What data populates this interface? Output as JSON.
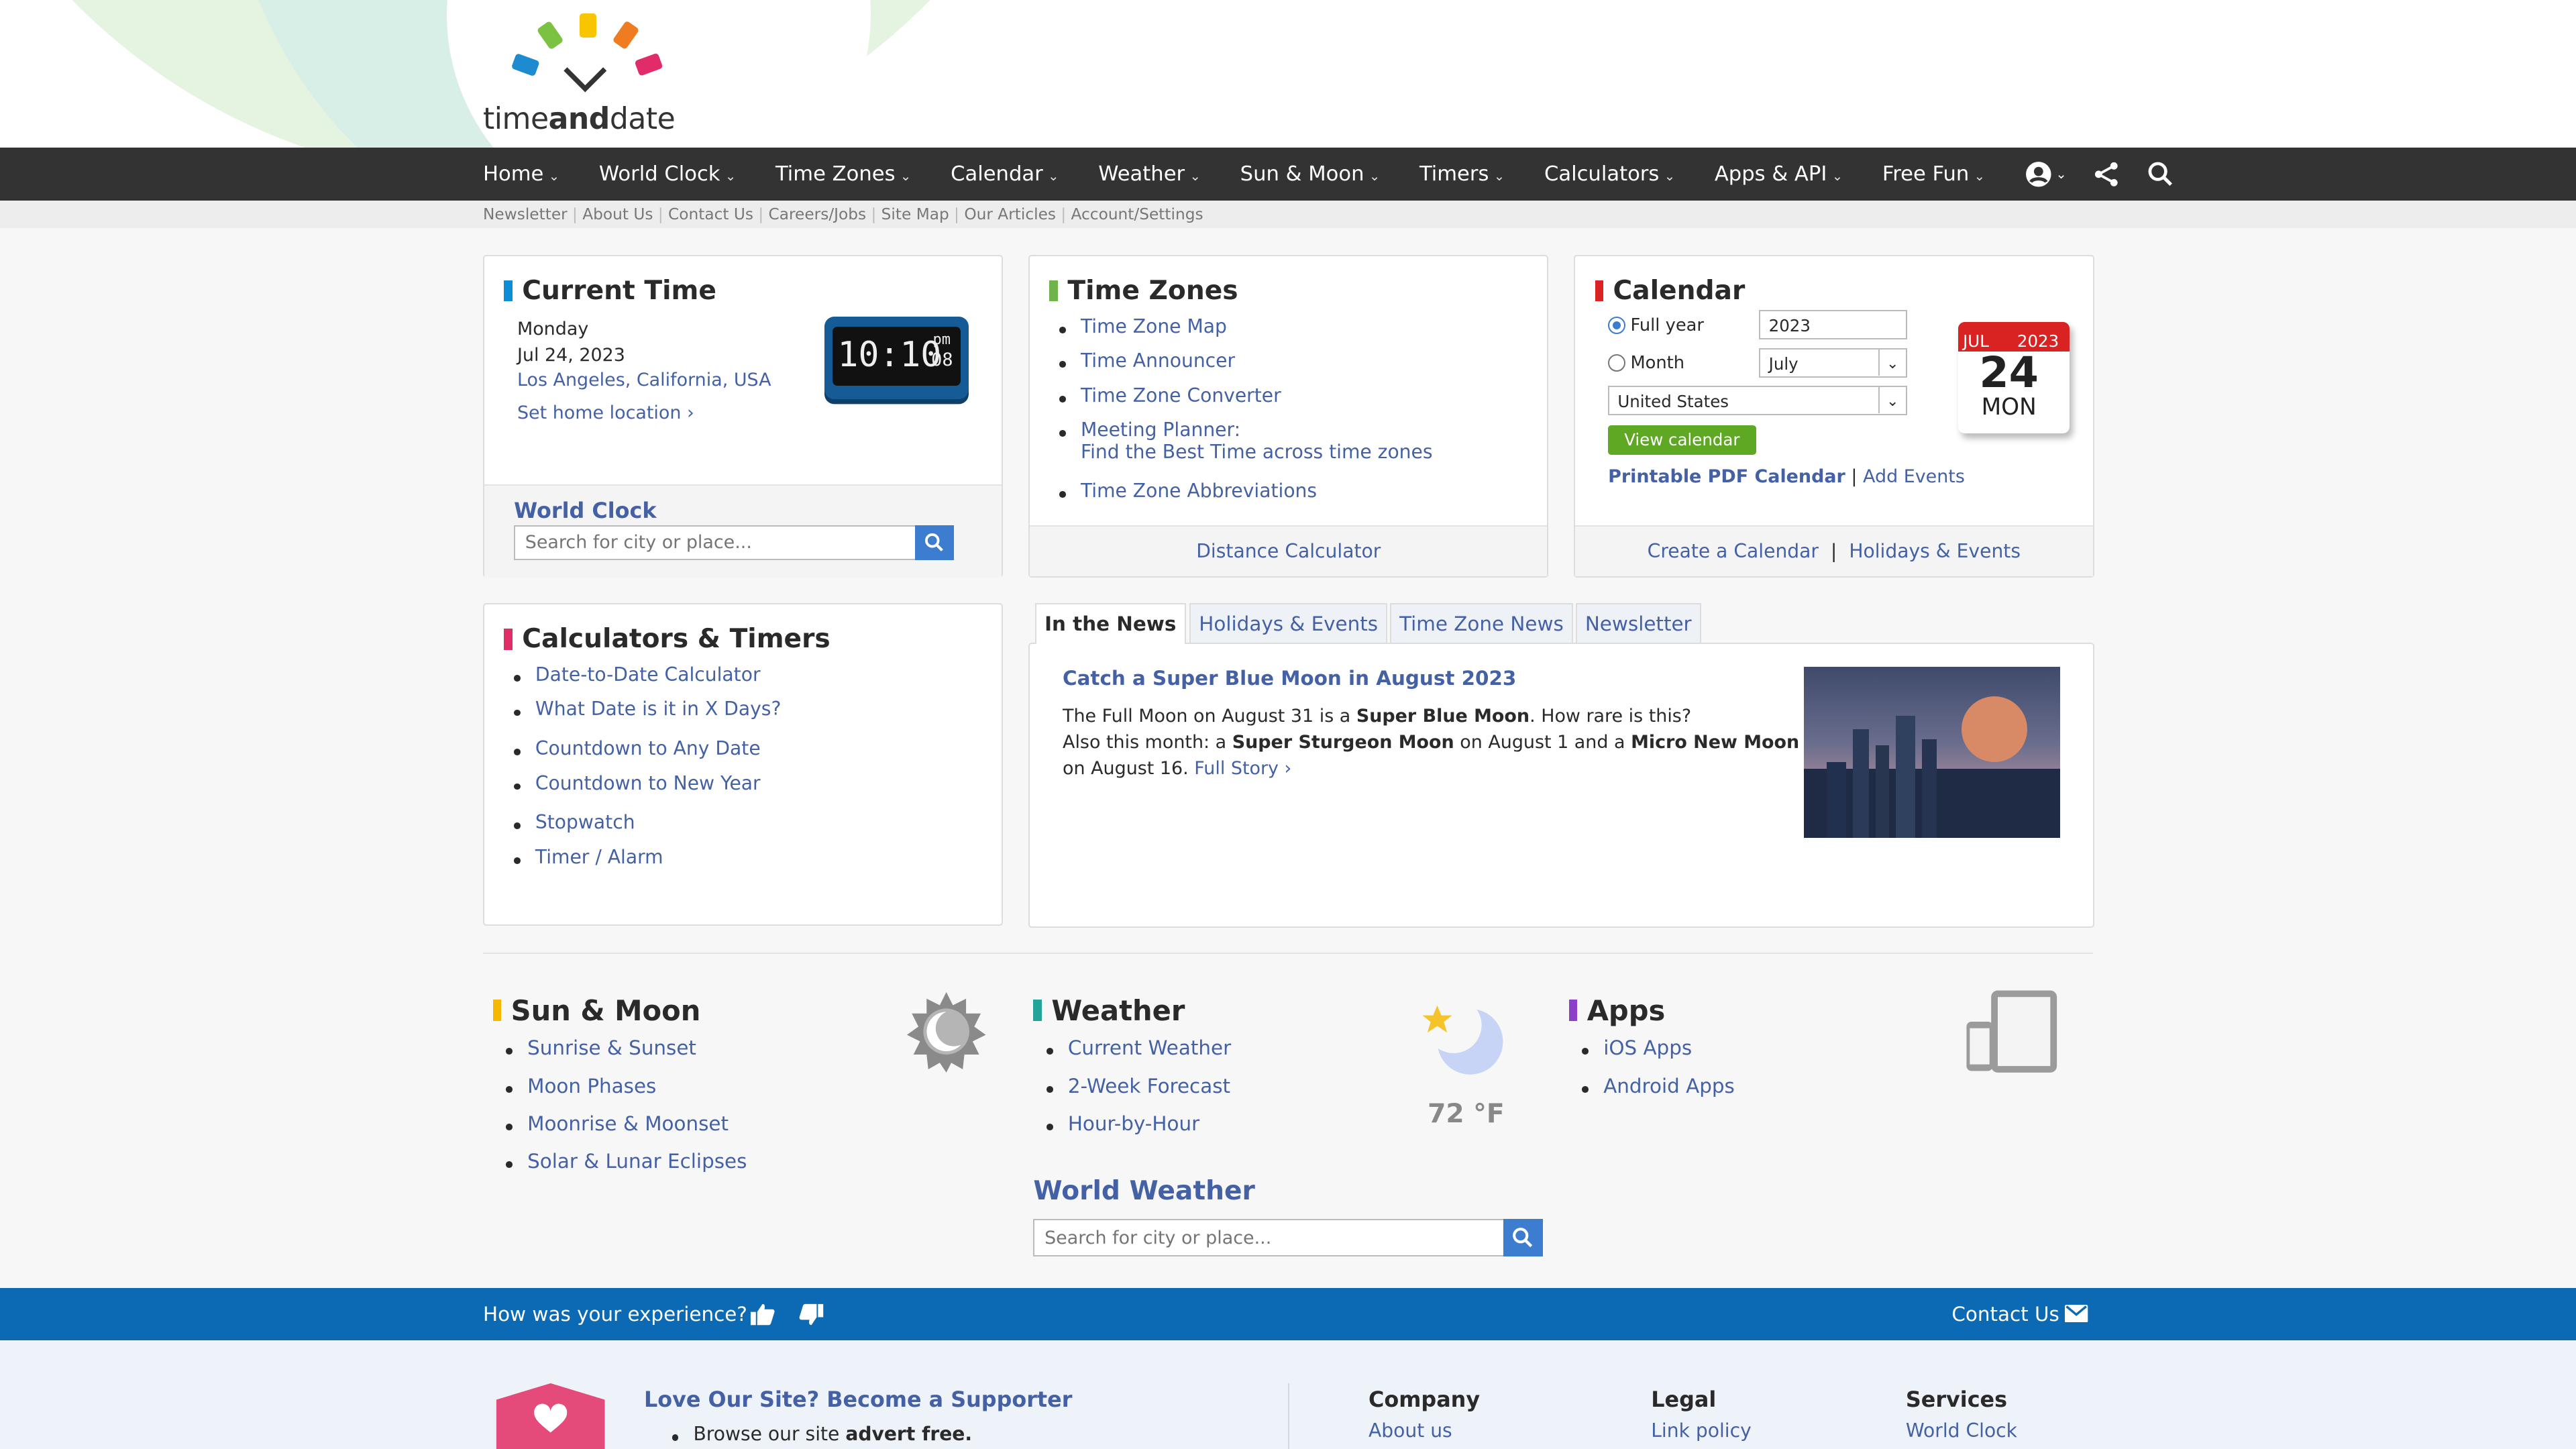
{
  "brand": {
    "logo_text_1": "time",
    "logo_text_2": "and",
    "logo_text_3": "date"
  },
  "nav": {
    "items": [
      "Home",
      "World Clock",
      "Time Zones",
      "Calendar",
      "Weather",
      "Sun & Moon",
      "Timers",
      "Calculators",
      "Apps & API",
      "Free Fun"
    ]
  },
  "subnav": [
    "Newsletter",
    "About Us",
    "Contact Us",
    "Careers/Jobs",
    "Site Map",
    "Our Articles",
    "Account/Settings"
  ],
  "current_time": {
    "title": "Current Time",
    "day": "Monday",
    "date": "Jul 24, 2023",
    "location": "Los Angeles, California, USA",
    "set_home": "Set home location",
    "clock_time": "10:10",
    "clock_ampm": "pm",
    "clock_sec": "08",
    "world_clock": "World Clock",
    "search_placeholder": "Search for city or place..."
  },
  "time_zones": {
    "title": "Time Zones",
    "links": [
      "Time Zone Map",
      "Time Announcer",
      "Time Zone Converter",
      "Meeting Planner:",
      "Find the Best Time across time zones",
      "Time Zone Abbreviations"
    ],
    "footer": "Distance Calculator"
  },
  "calendar": {
    "title": "Calendar",
    "full_year": "Full year",
    "month_label": "Month",
    "year_value": "2023",
    "month_value": "July",
    "country_value": "United States",
    "view_btn": "View calendar",
    "pdf": "Printable PDF Calendar",
    "sep": "|",
    "add_events": "Add Events",
    "footer_1": "Create a Calendar",
    "footer_sep": "|",
    "footer_2": "Holidays & Events",
    "icon_month": "JUL",
    "icon_year": "2023",
    "icon_day": "24",
    "icon_dow": "MON"
  },
  "calculators": {
    "title": "Calculators & Timers",
    "links": [
      "Date-to-Date Calculator",
      "What Date is it in X Days?",
      "Countdown to Any Date",
      "Countdown to New Year",
      "Stopwatch",
      "Timer / Alarm"
    ]
  },
  "news": {
    "tabs": [
      "In the News",
      "Holidays & Events",
      "Time Zone News",
      "Newsletter"
    ],
    "headline": "Catch a Super Blue Moon in August 2023",
    "p1a": "The Full Moon on August 31 is a ",
    "p1b": "Super Blue Moon",
    "p1c": ". How rare is this?",
    "p2a": "Also this month: a ",
    "p2b": "Super Sturgeon Moon",
    "p2c": " on August 1 and a ",
    "p2d": "Micro New Moon",
    "p3a": "on August 16. ",
    "p3b": "Full Story"
  },
  "sun_moon": {
    "title": "Sun & Moon",
    "links": [
      "Sunrise & Sunset",
      "Moon Phases",
      "Moonrise & Moonset",
      "Solar & Lunar Eclipses"
    ]
  },
  "weather": {
    "title": "Weather",
    "links": [
      "Current Weather",
      "2-Week Forecast",
      "Hour-by-Hour"
    ],
    "temp": "72 °F",
    "world_weather": "World Weather",
    "search_placeholder": "Search for city or place..."
  },
  "apps": {
    "title": "Apps",
    "links": [
      "iOS Apps",
      "Android Apps"
    ]
  },
  "feedback": {
    "question": "How was your experience?",
    "contact": "Contact Us"
  },
  "footer": {
    "supporter_title": "Love Our Site? Become a Supporter",
    "supporter_a": "Browse our site ",
    "supporter_b": "advert free.",
    "cols": [
      {
        "title": "Company",
        "link": "About us"
      },
      {
        "title": "Legal",
        "link": "Link policy"
      },
      {
        "title": "Services",
        "link": "World Clock"
      }
    ]
  },
  "colors": {
    "nav_bg": "#333333",
    "link": "#4461a5",
    "accent_blue": "#0b6ab3",
    "current_bar": "#0e8dd7",
    "tz_bar": "#6fb44a",
    "cal_bar": "#d92323",
    "calc_bar": "#e02d66",
    "sun_bar": "#f5b700",
    "weather_bar": "#23a39a",
    "apps_bar": "#8d3fc9"
  }
}
